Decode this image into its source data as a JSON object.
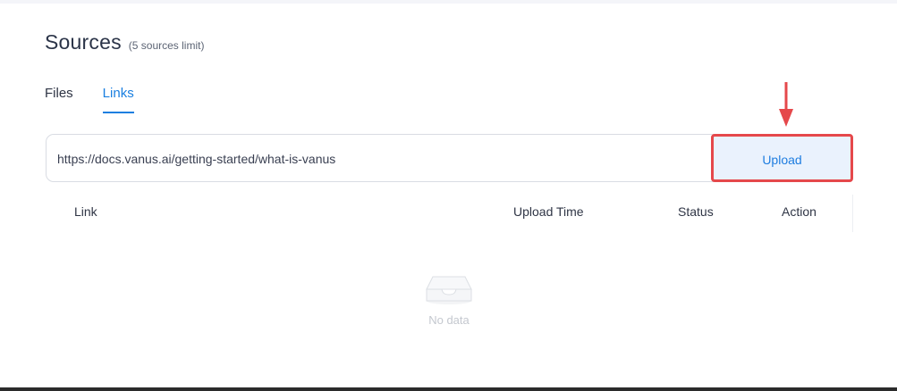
{
  "header": {
    "title": "Sources",
    "subtitle": "(5 sources limit)"
  },
  "tabs": [
    {
      "label": "Files",
      "active": false
    },
    {
      "label": "Links",
      "active": true
    }
  ],
  "url_input": {
    "value": "https://docs.vanus.ai/getting-started/what-is-vanus"
  },
  "upload_button": {
    "label": "Upload"
  },
  "table": {
    "columns": [
      "Link",
      "Upload Time",
      "Status",
      "Action"
    ],
    "rows": [],
    "empty_text": "No data"
  },
  "annotation": {
    "arrow_color": "#e5484b",
    "highlight_color": "#e5484b"
  },
  "colors": {
    "accent": "#1a7fe0",
    "upload_bg": "#eaf2fd"
  },
  "icons": {
    "empty": "empty-inbox-icon",
    "arrow": "arrow-down-icon"
  }
}
